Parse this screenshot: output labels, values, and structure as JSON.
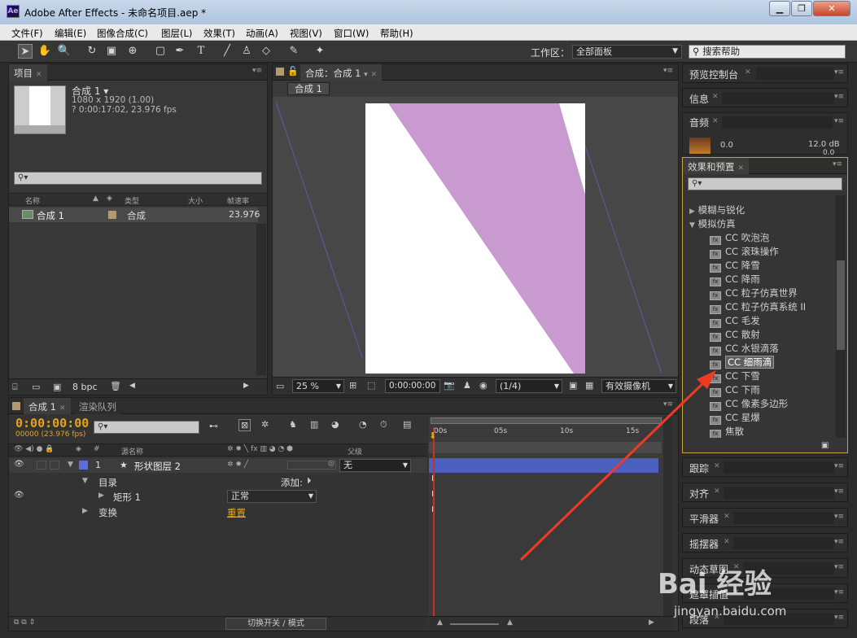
{
  "window": {
    "title": "Adobe After Effects - 未命名项目.aep *",
    "app_icon": "Ae",
    "minimize": "▁",
    "restore": "❐",
    "close": "✕"
  },
  "menu": [
    "文件(F)",
    "编辑(E)",
    "图像合成(C)",
    "图层(L)",
    "效果(T)",
    "动画(A)",
    "视图(V)",
    "窗口(W)",
    "帮助(H)"
  ],
  "toolbar": {
    "workspace_label": "工作区：",
    "workspace_value": "全部面板",
    "search_help": "搜索帮助"
  },
  "project_panel": {
    "tab": "项目",
    "comp_name": "合成 1 ▾",
    "comp_size": "1080 x 1920 (1.00)",
    "comp_duration": "? 0:00:17:02, 23.976 fps",
    "columns": [
      "名称",
      "类型",
      "大小",
      "帧速率"
    ],
    "row": {
      "name": "合成 1",
      "type": "合成",
      "fps": "23.976"
    },
    "bpc": "8 bpc"
  },
  "comp_panel": {
    "tab": "合成：合成 1",
    "sub_tab": "合成 1",
    "zoom": "25 %",
    "timecode": "0:00:00:00",
    "resolution": "(1/4)",
    "camera": "有效摄像机",
    "shape_color": "#c89ad0"
  },
  "right_panels": {
    "preview": "预览控制台",
    "info": "信息",
    "audio": "音频",
    "audio_values": {
      "left": "0.0",
      "right": "12.0 dB",
      "right2": "0.0"
    },
    "effects": "效果和预置",
    "categories": [
      "模糊与锐化",
      "模拟仿真"
    ],
    "effects_list": [
      "CC 吹泡泡",
      "CC 滚珠操作",
      "CC 降雪",
      "CC 降雨",
      "CC 粒子仿真世界",
      "CC 粒子仿真系统 II",
      "CC 毛发",
      "CC 散射",
      "CC 水银滴落",
      "CC 细雨滴",
      "CC 下雪",
      "CC 下雨",
      "CC 像素多边形",
      "CC 星爆",
      "焦散"
    ],
    "selected_effect": "CC 细雨滴",
    "collapsed": [
      "跟踪",
      "对齐",
      "平滑器",
      "摇摆器",
      "动态草图",
      "遮罩插值",
      "段落"
    ]
  },
  "timeline": {
    "tab": "合成 1",
    "render_tab": "渲染队列",
    "timecode": "0:00:00:00",
    "frames": "00000 (23.976 fps)",
    "col_name": "源名称",
    "col_parent": "父级",
    "layer_num": "1",
    "layer_name": "形状图层 2",
    "parent_value": "无",
    "contents": "目录",
    "add": "添加:",
    "rect": "矩形 1",
    "blend_mode": "正常",
    "transform": "变换",
    "reset": "重置",
    "ruler": [
      "00s",
      "05s",
      "10s",
      "15s"
    ],
    "footer": "切换开关 / 模式",
    "layer_color": "#5a6fd8"
  },
  "watermark": {
    "brand": "Bai 经验",
    "url": "jingyan.baidu.com"
  }
}
